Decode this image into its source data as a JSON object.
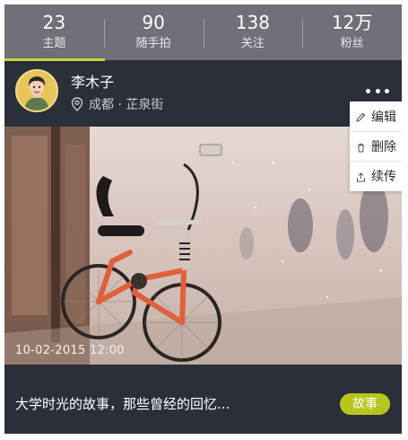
{
  "stats": [
    {
      "value": "23",
      "label": "主题"
    },
    {
      "value": "90",
      "label": "随手拍"
    },
    {
      "value": "138",
      "label": "关注"
    },
    {
      "value": "12万",
      "label": "粉丝"
    }
  ],
  "profile": {
    "name": "李木子",
    "location": "成都 · 芷泉街"
  },
  "menu": [
    {
      "icon": "pencil-icon",
      "label": "编辑"
    },
    {
      "icon": "trash-icon",
      "label": "删除"
    },
    {
      "icon": "share-icon",
      "label": "续传"
    }
  ],
  "photo": {
    "timestamp": "10-02-2015  12:00"
  },
  "post": {
    "caption": "大学时光的故事，那些曾经的回忆...",
    "tag": "故事"
  },
  "colors": {
    "accent": "#c9d33a",
    "tag_bg": "#b7c51e",
    "dark_bg": "#2b2f3a",
    "stats_bg": "#6f7078"
  }
}
